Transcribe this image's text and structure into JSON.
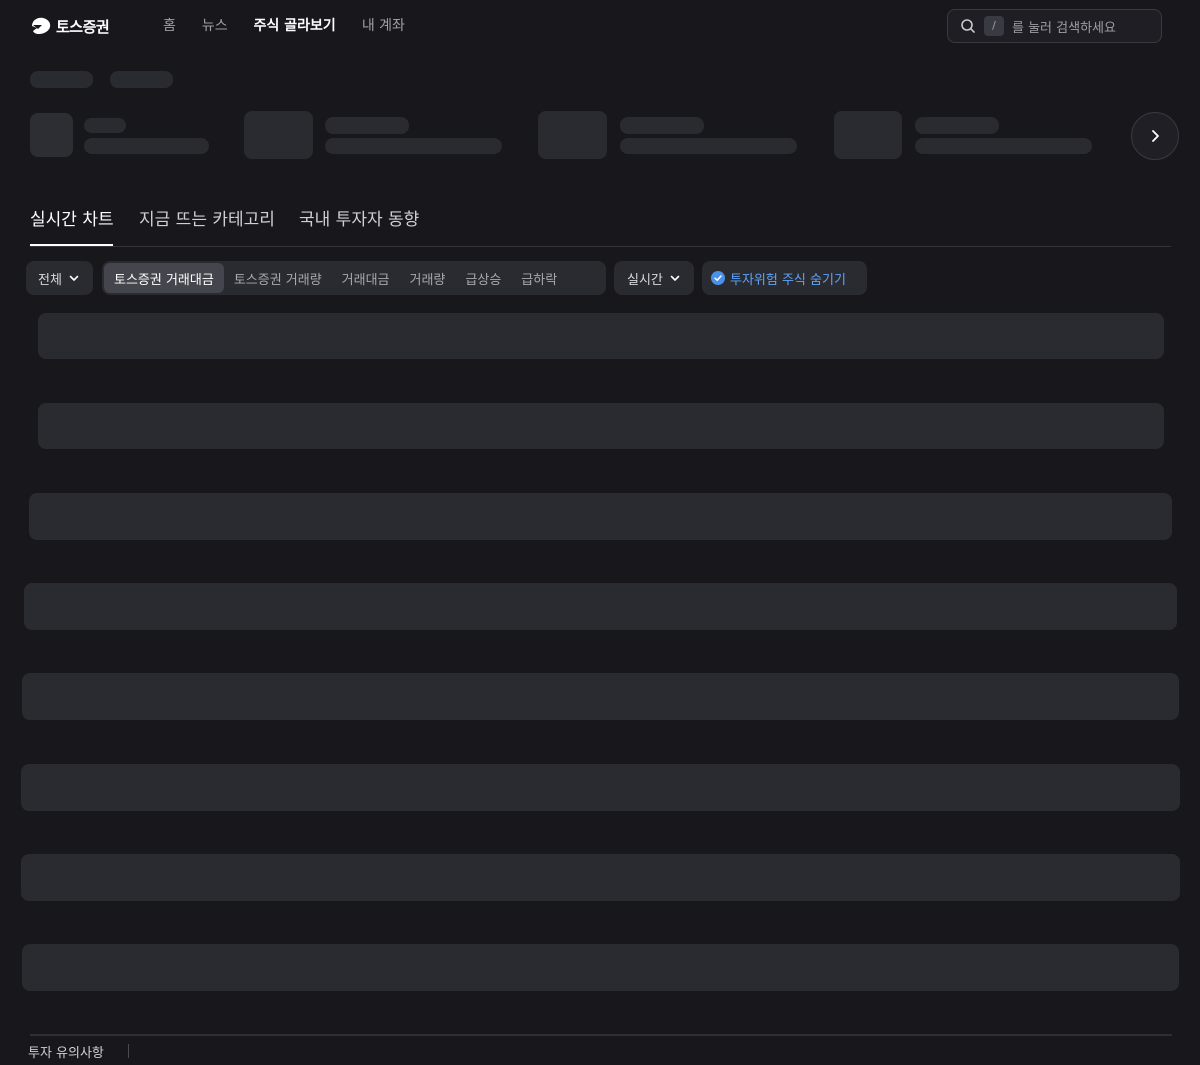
{
  "header": {
    "brand": "토스증권",
    "nav": [
      {
        "label": "홈",
        "active": false
      },
      {
        "label": "뉴스",
        "active": false
      },
      {
        "label": "주식 골라보기",
        "active": true
      },
      {
        "label": "내 계좌",
        "active": false
      }
    ],
    "search": {
      "shortcut": "/",
      "hint": "를 눌러 검색하세요"
    }
  },
  "tabs": [
    {
      "label": "실시간 차트",
      "active": true
    },
    {
      "label": "지금 뜨는 카테고리",
      "active": false
    },
    {
      "label": "국내 투자자 동향",
      "active": false
    }
  ],
  "filters": {
    "market": "전체",
    "ranking": [
      {
        "label": "토스증권 거래대금",
        "active": true
      },
      {
        "label": "토스증권 거래량",
        "active": false
      },
      {
        "label": "거래대금",
        "active": false
      },
      {
        "label": "거래량",
        "active": false
      },
      {
        "label": "급상승",
        "active": false
      },
      {
        "label": "급하락",
        "active": false
      }
    ],
    "period": "실시간",
    "hide_risk": "투자위험 주식 숨기기"
  },
  "footer": {
    "notice": "투자 유의사항"
  },
  "colors": {
    "background": "#17171c",
    "accent": "#5ea4f5",
    "skeleton": "#2a2a31"
  },
  "icons": [
    "toss-logo-icon",
    "search-icon",
    "chevron-right-icon",
    "chevron-down-icon",
    "check-circle-icon"
  ]
}
